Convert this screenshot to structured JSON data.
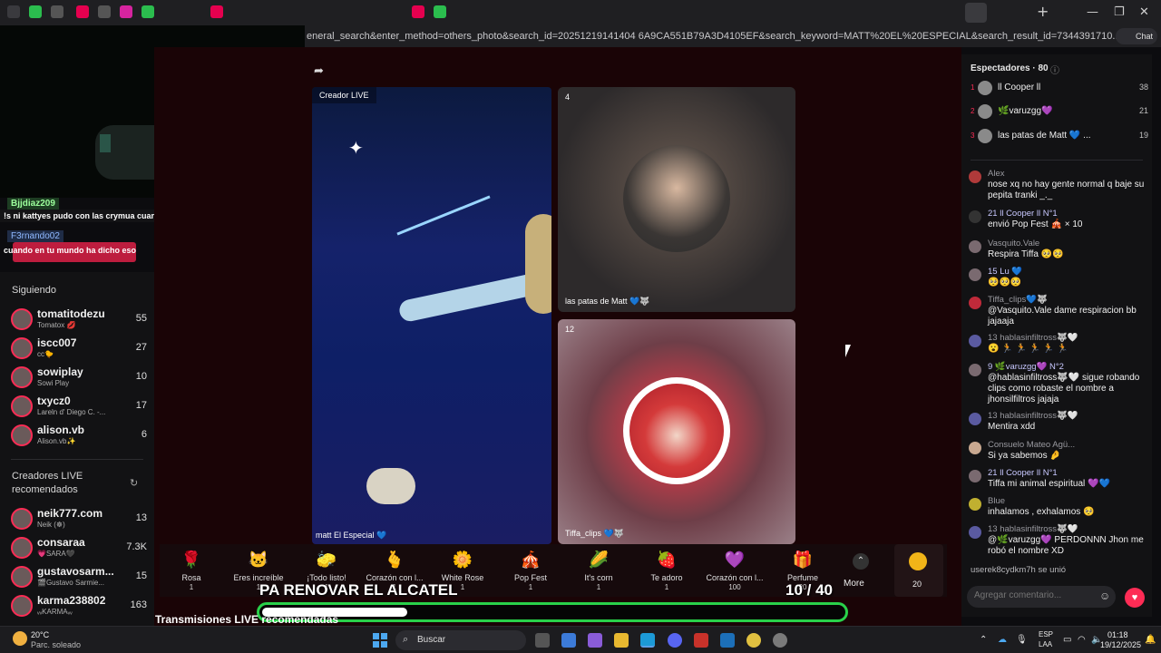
{
  "browser": {
    "url": "eneral_search&enter_method=others_photo&search_id=20251219141404 6A9CA551B79A3D4105EF&search_keyword=MATT%20EL%20ESPECIAL&search_result_id=7344391710...",
    "chat_button": "Chat"
  },
  "overlay": {
    "user1": "Bjjdiaz209",
    "msg1": "!s ni kattyes pudo con las crymua cuando colaboro con cry",
    "user2": "F3rnando02",
    "msg2": "cuando en tu mundo ha dicho eso"
  },
  "sidebar": {
    "following_title": "Siguiendo",
    "following": [
      {
        "name": "tomatitodezu",
        "sub": "Tomatox 💋",
        "count": "55"
      },
      {
        "name": "iscc007",
        "sub": "cc🐤",
        "count": "27"
      },
      {
        "name": "sowiplay",
        "sub": "Sowi Play",
        "count": "10"
      },
      {
        "name": "txycz0",
        "sub": "Lareln d' Diego C. -...",
        "count": "17"
      },
      {
        "name": "alison.vb",
        "sub": "Alison.vb✨",
        "count": "6"
      }
    ],
    "recommended_title": "Creadores LIVE recomendados",
    "recommended": [
      {
        "name": "neik777.com",
        "sub": "Neik (☸)",
        "count": "13"
      },
      {
        "name": "consaraa",
        "sub": "💗SARA🖤",
        "count": "7.3K"
      },
      {
        "name": "gustavosarm...",
        "sub": "🎬Gustavo Sarmie...",
        "count": "15"
      },
      {
        "name": "karma238802",
        "sub": "ᵥᵥKARMAᵥᵥ",
        "count": "163"
      }
    ]
  },
  "main": {
    "creator_label": "Creador LIVE",
    "host_name": "matt El Especial 💙",
    "tile1_viewers": "4",
    "tile1_name": "las patas de Matt 💙🐺",
    "tile2_viewers": "12",
    "tile2_name": "Tiffa_clips 💙🐺",
    "bottom_heading": "Transmisiones LIVE recomendadas",
    "banner_text": "PA RENOVAR EL ALCATEL",
    "progress_text": "10 / 40",
    "progress_fraction": 0.25
  },
  "gifts": [
    {
      "name": "Rosa",
      "price": "1",
      "icon": "🌹"
    },
    {
      "name": "Eres increíble",
      "price": "1",
      "icon": "🐱"
    },
    {
      "name": "¡Todo listo!",
      "price": "1",
      "icon": "🧽"
    },
    {
      "name": "Corazón con l...",
      "price": "1",
      "icon": "🫰"
    },
    {
      "name": "White Rose",
      "price": "1",
      "icon": "🌼"
    },
    {
      "name": "Pop Fest",
      "price": "1",
      "icon": "🎪"
    },
    {
      "name": "It's corn",
      "price": "1",
      "icon": "🌽"
    },
    {
      "name": "Te adoro",
      "price": "1",
      "icon": "🍓"
    },
    {
      "name": "Corazón con l...",
      "price": "100",
      "icon": "💜"
    },
    {
      "name": "Perfume",
      "price": "20",
      "icon": "🎁"
    }
  ],
  "gift_more": "More",
  "coins": "20",
  "panel": {
    "title": "Espectadores · 80",
    "ranking": [
      {
        "rank": "1",
        "name": "ll Cooper ll",
        "score": "38"
      },
      {
        "rank": "2",
        "name": "🌿varuzgg💜",
        "score": "21"
      },
      {
        "rank": "3",
        "name": "las patas de Matt 💙 ...",
        "score": "19"
      }
    ],
    "messages": [
      {
        "user": "Alex",
        "text": "nose xq no hay gente normal q baje su pepita tranki _._"
      },
      {
        "user": "21 ll Cooper ll N°1",
        "text": "envió Pop Fest 🎪 × 10"
      },
      {
        "user": "Vasquito.Vale",
        "text": "Respira Tiffa 🥺🥺"
      },
      {
        "user": "15 Lu 💙",
        "text": "🥺🥺🥺"
      },
      {
        "user": "Tiffa_clips💙🐺",
        "text": "@Vasquito.Vale dame respiracion bb jajaaja"
      },
      {
        "user": "13 hablasinfiltross🐺🤍",
        "text": "😮 🏃 🏃 🏃 🏃 🏃"
      },
      {
        "user": "9 🌿varuzgg💜 N°2",
        "text": "@hablasinfiltross🐺🤍 sigue robando clips como robaste el nombre a jhonsilfiltros jajaja"
      },
      {
        "user": "13 hablasinfiltross🐺🤍",
        "text": "Mentira xdd"
      },
      {
        "user": "Consuelo Mateo Agü...",
        "text": "Si ya sabemos 🤌"
      },
      {
        "user": "21 ll Cooper ll N°1",
        "text": "Tiffa mi animal espiritual 💜💙"
      },
      {
        "user": "Blue",
        "text": "inhalamos , exhalamos 🥺"
      },
      {
        "user": "13 hablasinfiltross🐺🤍",
        "text": "@🌿varuzgg💜 PERDONNN Jhon me robó el nombre XD"
      }
    ],
    "joined": "userek8cydkm7h  se unió",
    "comment_placeholder": "Agregar comentario..."
  },
  "taskbar": {
    "weather_temp": "20°C",
    "weather_desc": "Parc. soleado",
    "search": "Buscar",
    "lang1": "ESP",
    "lang2": "LAA",
    "time": "01:18",
    "date": "19/12/2025"
  },
  "colors": {
    "accent": "#fe2c55",
    "progress": "#29d14a"
  }
}
